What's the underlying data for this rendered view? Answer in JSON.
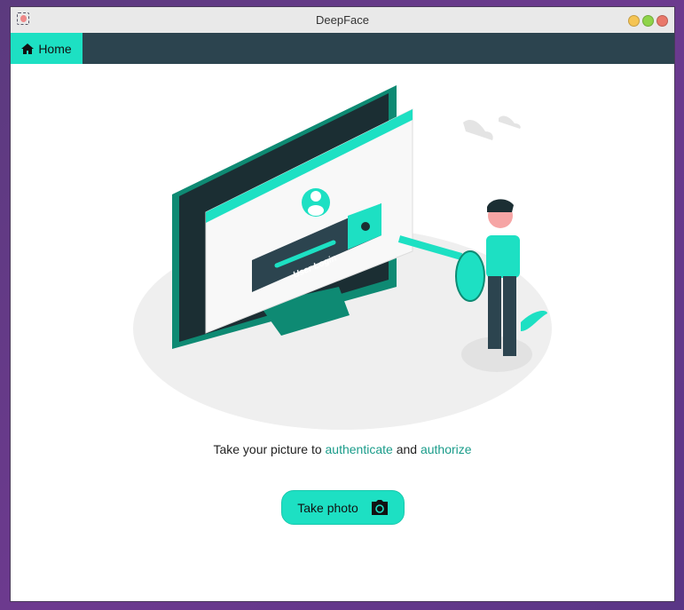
{
  "window": {
    "title": "DeepFace",
    "controls": [
      "minimize",
      "maximize",
      "close"
    ]
  },
  "nav": {
    "home_label": "Home",
    "home_icon": "home-icon"
  },
  "illustration": {
    "login_label": "User Login"
  },
  "main": {
    "caption_prefix": "Take your picture to ",
    "caption_link1": "authenticate",
    "caption_mid": " and ",
    "caption_link2": "authorize",
    "take_photo_label": "Take photo",
    "take_photo_icon": "camera-icon"
  },
  "colors": {
    "accent": "#1de0c3",
    "nav": "#2c444f",
    "link": "#1a9c8a"
  }
}
